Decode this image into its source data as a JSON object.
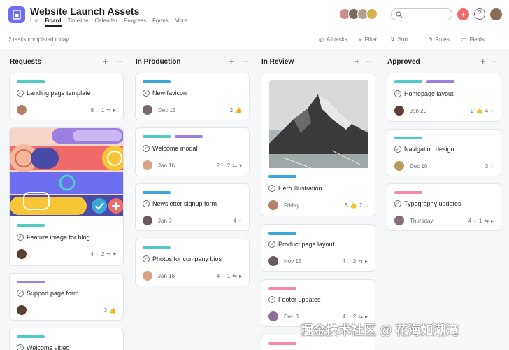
{
  "header": {
    "title": "Website Launch Assets",
    "tabs": [
      "List",
      "Board",
      "Timeline",
      "Calendar",
      "Progress",
      "Forms",
      "More..."
    ],
    "active_tab": "Board"
  },
  "toolbar": {
    "tasks_completed": "2 tasks completed today",
    "all_tasks": "All tasks",
    "filter": "Filter",
    "sort": "Sort",
    "rules": "Rules",
    "fields": "Fields"
  },
  "columns": [
    {
      "name": "Requests"
    },
    {
      "name": "In Production"
    },
    {
      "name": "In Review"
    },
    {
      "name": "Approved"
    }
  ],
  "cards": {
    "req1": {
      "title": "Landing page template",
      "comments": "8",
      "subtasks": "1"
    },
    "req2": {
      "title": "Feature image for blog",
      "comments": "4",
      "subtasks": "2"
    },
    "req3": {
      "title": "Support page form",
      "likes": "3"
    },
    "req4": {
      "title": "Welcome video"
    },
    "prod1": {
      "title": "New favicon",
      "date": "Dec 15",
      "likes": "2"
    },
    "prod2": {
      "title": "Welcome modal",
      "date": "Jan 16",
      "comments": "2",
      "subtasks": "2"
    },
    "prod3": {
      "title": "Newsletter signup form",
      "date": "Jan 7",
      "comments": "4"
    },
    "prod4": {
      "title": "Photos for company bios",
      "date": "Jan 16",
      "comments": "4",
      "subtasks": "1"
    },
    "rev1": {
      "title": "Hero illustration",
      "date": "Friday",
      "likes": "5",
      "comments": "2"
    },
    "rev2": {
      "title": "Product page layout",
      "date": "Nov 15",
      "comments": "4",
      "subtasks": "2"
    },
    "rev3": {
      "title": "Footer updates",
      "date": "Dec 3",
      "comments": "4",
      "subtasks": "2"
    },
    "app1": {
      "title": "Homepage layout",
      "date": "Jan 20",
      "likes": "2",
      "comments": "4"
    },
    "app2": {
      "title": "Navigation design",
      "date": "Dec 10",
      "comments": "3"
    },
    "app3": {
      "title": "Typography updates",
      "date": "Thursday",
      "comments": "4",
      "subtasks": "1"
    }
  },
  "colors": {
    "green": "#4ecbc4",
    "purple": "#9b80e0",
    "blue": "#3aa8d8",
    "pink": "#f28aac",
    "accent": "#f06a6a"
  },
  "watermark": "掘金技术社区 @ 花海如潮淹"
}
